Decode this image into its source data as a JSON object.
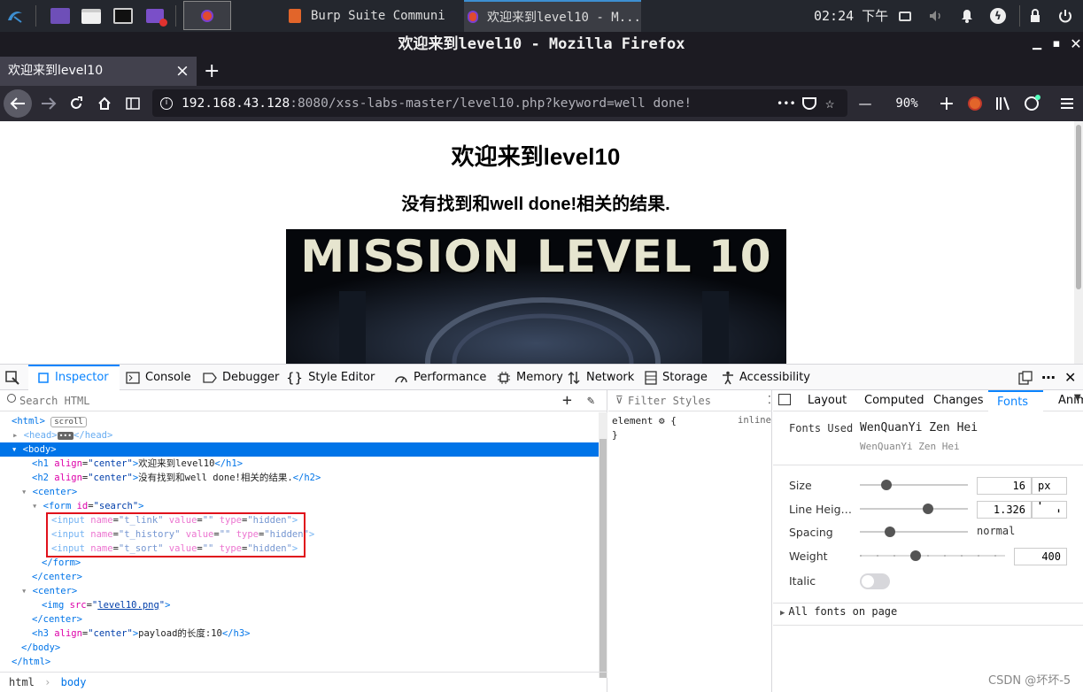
{
  "taskbar": {
    "tasks": [
      "Burp Suite Communi",
      "欢迎来到level10 - M..."
    ],
    "clock": "02:24 下午"
  },
  "window": {
    "title": "欢迎来到level10 - Mozilla Firefox"
  },
  "tabs": [
    {
      "label": "欢迎来到level10",
      "close": "×"
    }
  ],
  "new_tab": "+",
  "nav": {
    "url_host": "192.168.43.128",
    "url_rest": ":8080/xss-labs-master/level10.php?keyword=well done!",
    "more": "•••",
    "zoom": "90%",
    "zoom_minus": "—",
    "zoom_plus": "+"
  },
  "page": {
    "h1": "欢迎来到level10",
    "h2": "没有找到和well done!相关的结果.",
    "image_text": "MISSION LEVEL 10"
  },
  "devtools": {
    "tabs": [
      "Inspector",
      "Console",
      "Debugger",
      "Style Editor",
      "Performance",
      "Memory",
      "Network",
      "Storage",
      "Accessibility"
    ],
    "search_placeholder": "Search HTML",
    "filter_placeholder": "Filter Styles",
    "rule_selector": "element",
    "rule_open": "{",
    "rule_close": "}",
    "rule_inline": "inline",
    "breadcrumbs": [
      "html",
      "body"
    ],
    "scroll_badge": "scroll",
    "right_tabs": [
      "Layout",
      "Computed",
      "Changes",
      "Fonts",
      "Anim"
    ],
    "fonts": {
      "fonts_used_label": "Fonts Used",
      "font_name": "WenQuanYi Zen Hei",
      "font_sub": "WenQuanYi Zen Hei",
      "size_label": "Size",
      "size_value": "16",
      "size_unit": "px",
      "lh_label": "Line Heig…",
      "lh_value": "1.326",
      "spacing_label": "Spacing",
      "spacing_value": "normal",
      "weight_label": "Weight",
      "weight_value": "400",
      "italic_label": "Italic",
      "all_fonts": "All fonts on page"
    }
  },
  "watermark": "CSDN @坏坏-5"
}
